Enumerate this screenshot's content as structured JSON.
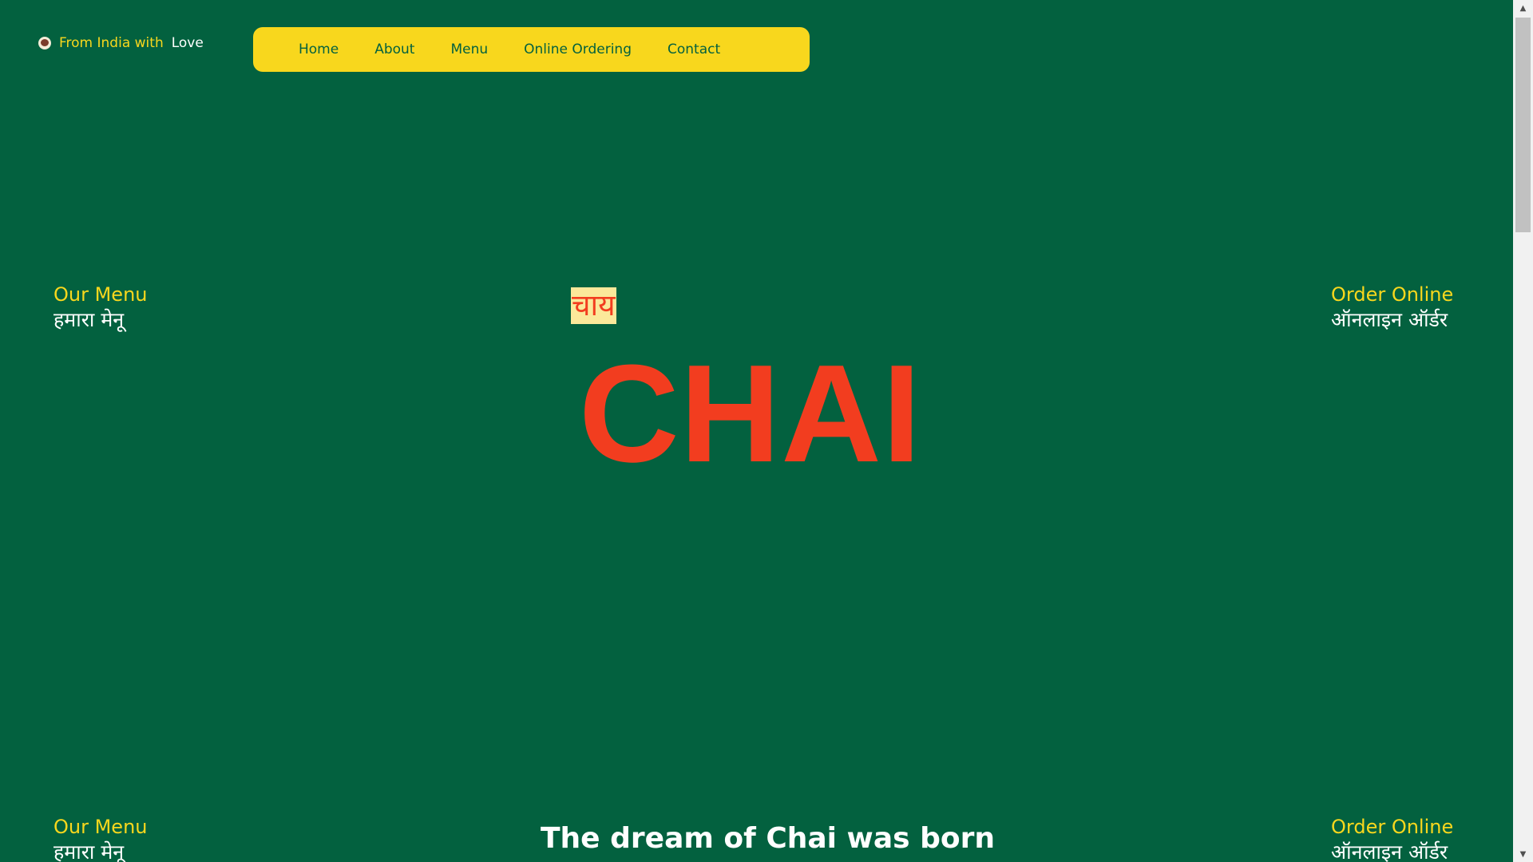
{
  "logo": {
    "icon": "chai-cup-icon",
    "text_pre": "From India with",
    "text_post": "Love"
  },
  "nav": {
    "items": [
      {
        "label": "Home"
      },
      {
        "label": "About"
      },
      {
        "label": "Menu"
      },
      {
        "label": "Online Ordering"
      },
      {
        "label": "Contact"
      }
    ]
  },
  "hero": {
    "hindi_label": "चाय",
    "title": "CHAI"
  },
  "side_links": {
    "menu_en": "Our Menu",
    "menu_hi": "हमारा मेनू",
    "order_en": "Order Online",
    "order_hi": "ऑनलाइन ऑर्डर"
  },
  "section": {
    "heading": "The dream of Chai was born"
  },
  "colors": {
    "background": "#03613f",
    "accent_yellow": "#f8d71d",
    "accent_red": "#f23d1f",
    "highlight": "#fbe89a"
  }
}
